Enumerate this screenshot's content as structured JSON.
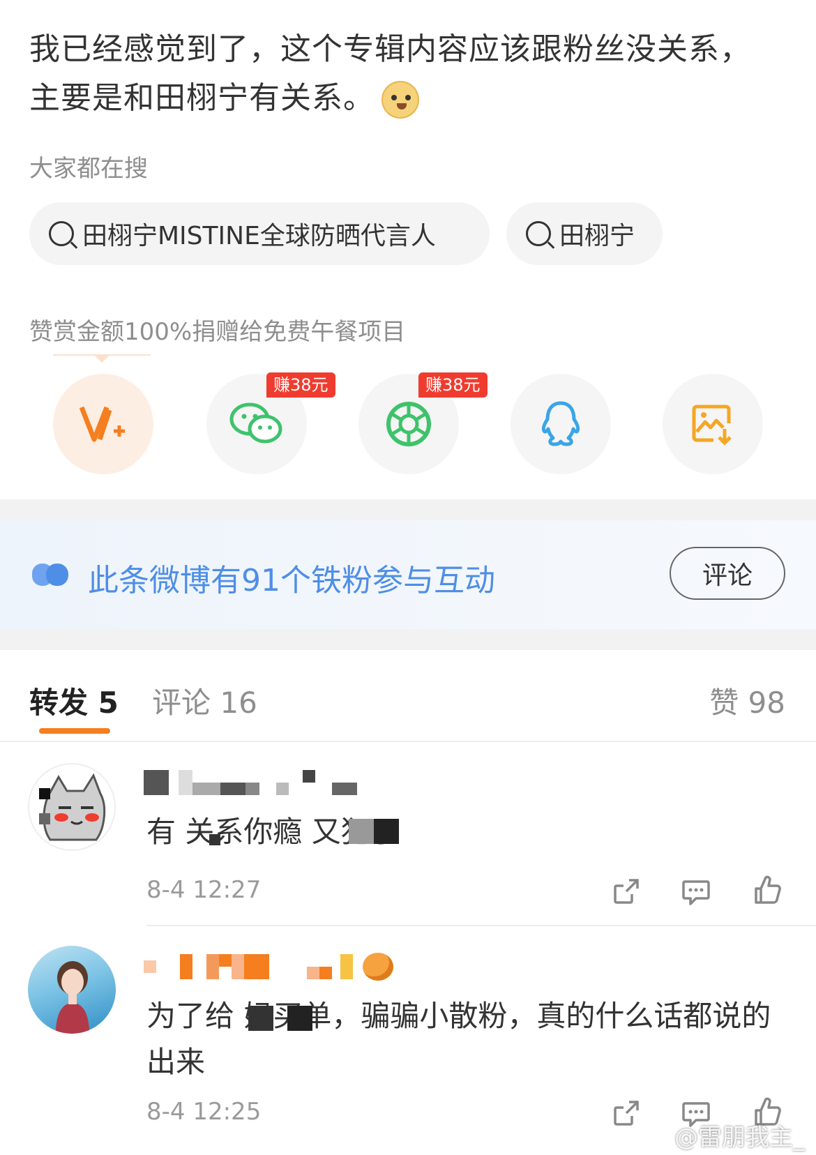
{
  "post": {
    "text": "我已经感觉到了，这个专辑内容应该跟粉丝没关系，主要是和田栩宁有关系。",
    "emoji": "doge-emoji"
  },
  "trending": {
    "label": "大家都在搜",
    "chips": [
      {
        "text": "田栩宁MISTINE全球防晒代言人",
        "icon": "search-icon"
      },
      {
        "text": "田栩宁",
        "icon": "search-icon"
      }
    ]
  },
  "reward": {
    "label": "赞赏金额100%捐赠给免费午餐项目"
  },
  "share": {
    "items": [
      {
        "name": "vplus",
        "icon": "vplus-icon"
      },
      {
        "name": "wechat",
        "icon": "wechat-icon",
        "badge": "赚38元"
      },
      {
        "name": "moments",
        "icon": "moments-icon",
        "badge": "赚38元"
      },
      {
        "name": "qq",
        "icon": "qq-icon"
      },
      {
        "name": "save-image",
        "icon": "save-image-icon"
      }
    ]
  },
  "fans_banner": {
    "text": "此条微博有91个铁粉参与互动",
    "button": "评论"
  },
  "tabs": {
    "repost": "转发 5",
    "comment": "评论 16",
    "like": "赞 98"
  },
  "comments": [
    {
      "text": "有 关系你瘾 又犯了",
      "time": "8-4 12:27"
    },
    {
      "text": "为了给 妈买单，骗骗小散粉，真的什么话都说的出来",
      "time": "8-4 12:25"
    }
  ],
  "watermark": "@雷朋我主_",
  "colors": {
    "accent_orange": "#f57e1f",
    "link_blue": "#4e8ee6",
    "badge_red": "#ef3c2f",
    "wechat_green": "#3ec36b",
    "qq_blue": "#3aa4e8",
    "save_orange": "#f5a623"
  }
}
